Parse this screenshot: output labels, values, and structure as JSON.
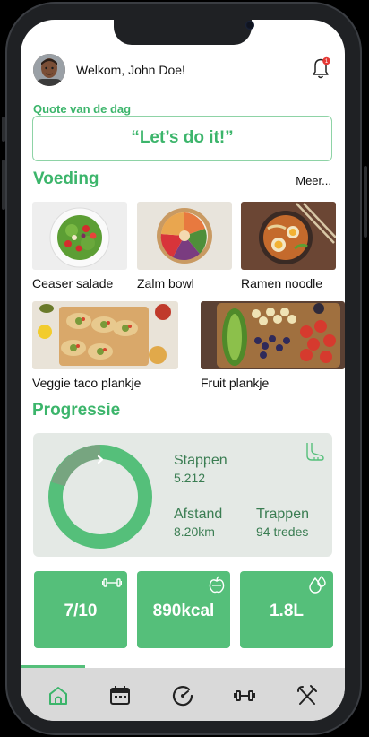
{
  "header": {
    "welcome_text": "Welkom, John Doe!"
  },
  "quote": {
    "title": "Quote van de dag",
    "text": "“Let’s do it!”"
  },
  "nutrition": {
    "title": "Voeding",
    "more_label": "Meer...",
    "items": [
      {
        "label": "Ceaser salade"
      },
      {
        "label": "Zalm bowl"
      },
      {
        "label": "Ramen noodle"
      },
      {
        "label": "Veggie taco plankje"
      },
      {
        "label": "Fruit plankje"
      }
    ]
  },
  "progress": {
    "title": "Progressie",
    "steps_label": "Stappen",
    "steps_value": "5.212",
    "distance_label": "Afstand",
    "distance_value": "8.20km",
    "stairs_label": "Trappen",
    "stairs_value": "94 tredes"
  },
  "tiles": [
    {
      "value": "7/10",
      "icon": "dumbbell-icon"
    },
    {
      "value": "890kcal",
      "icon": "apple-icon"
    },
    {
      "value": "1.8L",
      "icon": "water-drop-icon"
    }
  ],
  "nav": {
    "items": [
      "home-icon",
      "calendar-icon",
      "progress-dial-icon",
      "dumbbell-icon",
      "cutlery-icon"
    ],
    "active_index": 0
  },
  "colors": {
    "accent": "#3cb56b",
    "tile": "#55bf7a",
    "card": "#e4e9e5",
    "nav": "#d9d9d9"
  }
}
